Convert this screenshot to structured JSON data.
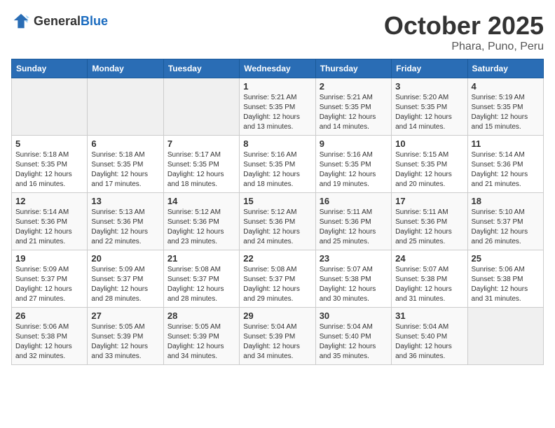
{
  "header": {
    "logo_general": "General",
    "logo_blue": "Blue",
    "month": "October 2025",
    "location": "Phara, Puno, Peru"
  },
  "days_of_week": [
    "Sunday",
    "Monday",
    "Tuesday",
    "Wednesday",
    "Thursday",
    "Friday",
    "Saturday"
  ],
  "weeks": [
    [
      {
        "day": "",
        "sunrise": "",
        "sunset": "",
        "daylight": ""
      },
      {
        "day": "",
        "sunrise": "",
        "sunset": "",
        "daylight": ""
      },
      {
        "day": "",
        "sunrise": "",
        "sunset": "",
        "daylight": ""
      },
      {
        "day": "1",
        "sunrise": "Sunrise: 5:21 AM",
        "sunset": "Sunset: 5:35 PM",
        "daylight": "Daylight: 12 hours and 13 minutes."
      },
      {
        "day": "2",
        "sunrise": "Sunrise: 5:21 AM",
        "sunset": "Sunset: 5:35 PM",
        "daylight": "Daylight: 12 hours and 14 minutes."
      },
      {
        "day": "3",
        "sunrise": "Sunrise: 5:20 AM",
        "sunset": "Sunset: 5:35 PM",
        "daylight": "Daylight: 12 hours and 14 minutes."
      },
      {
        "day": "4",
        "sunrise": "Sunrise: 5:19 AM",
        "sunset": "Sunset: 5:35 PM",
        "daylight": "Daylight: 12 hours and 15 minutes."
      }
    ],
    [
      {
        "day": "5",
        "sunrise": "Sunrise: 5:18 AM",
        "sunset": "Sunset: 5:35 PM",
        "daylight": "Daylight: 12 hours and 16 minutes."
      },
      {
        "day": "6",
        "sunrise": "Sunrise: 5:18 AM",
        "sunset": "Sunset: 5:35 PM",
        "daylight": "Daylight: 12 hours and 17 minutes."
      },
      {
        "day": "7",
        "sunrise": "Sunrise: 5:17 AM",
        "sunset": "Sunset: 5:35 PM",
        "daylight": "Daylight: 12 hours and 18 minutes."
      },
      {
        "day": "8",
        "sunrise": "Sunrise: 5:16 AM",
        "sunset": "Sunset: 5:35 PM",
        "daylight": "Daylight: 12 hours and 18 minutes."
      },
      {
        "day": "9",
        "sunrise": "Sunrise: 5:16 AM",
        "sunset": "Sunset: 5:35 PM",
        "daylight": "Daylight: 12 hours and 19 minutes."
      },
      {
        "day": "10",
        "sunrise": "Sunrise: 5:15 AM",
        "sunset": "Sunset: 5:35 PM",
        "daylight": "Daylight: 12 hours and 20 minutes."
      },
      {
        "day": "11",
        "sunrise": "Sunrise: 5:14 AM",
        "sunset": "Sunset: 5:36 PM",
        "daylight": "Daylight: 12 hours and 21 minutes."
      }
    ],
    [
      {
        "day": "12",
        "sunrise": "Sunrise: 5:14 AM",
        "sunset": "Sunset: 5:36 PM",
        "daylight": "Daylight: 12 hours and 21 minutes."
      },
      {
        "day": "13",
        "sunrise": "Sunrise: 5:13 AM",
        "sunset": "Sunset: 5:36 PM",
        "daylight": "Daylight: 12 hours and 22 minutes."
      },
      {
        "day": "14",
        "sunrise": "Sunrise: 5:12 AM",
        "sunset": "Sunset: 5:36 PM",
        "daylight": "Daylight: 12 hours and 23 minutes."
      },
      {
        "day": "15",
        "sunrise": "Sunrise: 5:12 AM",
        "sunset": "Sunset: 5:36 PM",
        "daylight": "Daylight: 12 hours and 24 minutes."
      },
      {
        "day": "16",
        "sunrise": "Sunrise: 5:11 AM",
        "sunset": "Sunset: 5:36 PM",
        "daylight": "Daylight: 12 hours and 25 minutes."
      },
      {
        "day": "17",
        "sunrise": "Sunrise: 5:11 AM",
        "sunset": "Sunset: 5:36 PM",
        "daylight": "Daylight: 12 hours and 25 minutes."
      },
      {
        "day": "18",
        "sunrise": "Sunrise: 5:10 AM",
        "sunset": "Sunset: 5:37 PM",
        "daylight": "Daylight: 12 hours and 26 minutes."
      }
    ],
    [
      {
        "day": "19",
        "sunrise": "Sunrise: 5:09 AM",
        "sunset": "Sunset: 5:37 PM",
        "daylight": "Daylight: 12 hours and 27 minutes."
      },
      {
        "day": "20",
        "sunrise": "Sunrise: 5:09 AM",
        "sunset": "Sunset: 5:37 PM",
        "daylight": "Daylight: 12 hours and 28 minutes."
      },
      {
        "day": "21",
        "sunrise": "Sunrise: 5:08 AM",
        "sunset": "Sunset: 5:37 PM",
        "daylight": "Daylight: 12 hours and 28 minutes."
      },
      {
        "day": "22",
        "sunrise": "Sunrise: 5:08 AM",
        "sunset": "Sunset: 5:37 PM",
        "daylight": "Daylight: 12 hours and 29 minutes."
      },
      {
        "day": "23",
        "sunrise": "Sunrise: 5:07 AM",
        "sunset": "Sunset: 5:38 PM",
        "daylight": "Daylight: 12 hours and 30 minutes."
      },
      {
        "day": "24",
        "sunrise": "Sunrise: 5:07 AM",
        "sunset": "Sunset: 5:38 PM",
        "daylight": "Daylight: 12 hours and 31 minutes."
      },
      {
        "day": "25",
        "sunrise": "Sunrise: 5:06 AM",
        "sunset": "Sunset: 5:38 PM",
        "daylight": "Daylight: 12 hours and 31 minutes."
      }
    ],
    [
      {
        "day": "26",
        "sunrise": "Sunrise: 5:06 AM",
        "sunset": "Sunset: 5:38 PM",
        "daylight": "Daylight: 12 hours and 32 minutes."
      },
      {
        "day": "27",
        "sunrise": "Sunrise: 5:05 AM",
        "sunset": "Sunset: 5:39 PM",
        "daylight": "Daylight: 12 hours and 33 minutes."
      },
      {
        "day": "28",
        "sunrise": "Sunrise: 5:05 AM",
        "sunset": "Sunset: 5:39 PM",
        "daylight": "Daylight: 12 hours and 34 minutes."
      },
      {
        "day": "29",
        "sunrise": "Sunrise: 5:04 AM",
        "sunset": "Sunset: 5:39 PM",
        "daylight": "Daylight: 12 hours and 34 minutes."
      },
      {
        "day": "30",
        "sunrise": "Sunrise: 5:04 AM",
        "sunset": "Sunset: 5:40 PM",
        "daylight": "Daylight: 12 hours and 35 minutes."
      },
      {
        "day": "31",
        "sunrise": "Sunrise: 5:04 AM",
        "sunset": "Sunset: 5:40 PM",
        "daylight": "Daylight: 12 hours and 36 minutes."
      },
      {
        "day": "",
        "sunrise": "",
        "sunset": "",
        "daylight": ""
      }
    ]
  ]
}
